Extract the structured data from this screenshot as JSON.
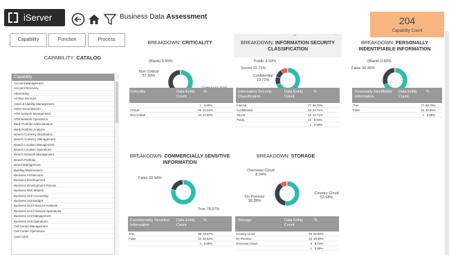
{
  "app": {
    "name": "iServer",
    "title_prefix": "Business Data ",
    "title_bold": "Assessment"
  },
  "kpi": {
    "value": "204",
    "label": "Capability Count",
    "color": "#f7b681"
  },
  "tabs": [
    "Capability",
    "Function",
    "Process"
  ],
  "catalog": {
    "prefix": "CAPABILITY: ",
    "bold": "CATALOG",
    "header": "Capability",
    "items": [
      "Account Management",
      "Account Recovery",
      "Advertising",
      "Archive Services",
      "Asset & Liability Management",
      "Asset Securitisation",
      "ATM Network Management",
      "ATM Network Operations",
      "Bank Portfolio Administration",
      "Bank Portfolio Analysis",
      "Branch Currency Distribution",
      "Branch Currency Management",
      "Branch Location Management",
      "Branch Location Operations",
      "Branch Network Management",
      "Branch Portfolio",
      "Brand Management",
      "Building Maintenance",
      "Business Architecture",
      "Business Development",
      "Business Development Policies",
      "Business Risk Models",
      "Business Unit Accounting",
      "Business Unit Budget",
      "Business Unit Financial Analysis",
      "Business Unit Financial Operations",
      "Business Unit Management",
      "Business Unit Operations",
      "Call Center Management",
      "Call Center Operations",
      "Card Case"
    ]
  },
  "charts": {
    "criticality": {
      "prefix": "BREAKDOWN: ",
      "bold": "CRITICALITY",
      "col1": "Criticality",
      "col2": "Data Entity Count",
      "col3": "%",
      "rows": [
        [
          "",
          "1",
          "0.89%"
        ],
        [
          "Critical",
          "69",
          "61.61%"
        ],
        [
          "Non Critical",
          "42",
          "37.50%"
        ]
      ],
      "labels": {
        "blank": "(Blank) 0.89%",
        "noncrit": "Non Critical 37.50%",
        "crit": "Critical 61.61%"
      }
    },
    "security": {
      "prefix": "BREAKDOWN: ",
      "bold": "INFORMATION SECURITY CLASSIFICATION",
      "col1": "Information Security Classification",
      "col2": "Data Entity Count",
      "col3": "%",
      "rows": [
        [
          "Internal",
          "77",
          "68.75%"
        ],
        [
          "Confidential",
          "12",
          "10.71%"
        ],
        [
          "Secret",
          "12",
          "10.71%"
        ],
        [
          "Public",
          "10",
          "8.93%"
        ],
        [
          "",
          "1",
          "0.89%"
        ]
      ],
      "labels": {
        "public": "Public 8.93%",
        "secret": "Secret 10.71%",
        "conf": "Confidential 10.71%",
        "internal": "Internal 68.75%"
      }
    },
    "pii": {
      "prefix": "BREAKDOWN: ",
      "bold": "PERSONALLY INDENTIFIABLE INFORMATION",
      "col1": "Personally Identifiable Information",
      "col2": "Data Entity Count",
      "col3": "%",
      "rows": [
        [
          "True",
          "77",
          "68.75%"
        ],
        [
          "False",
          "34",
          "30.36%"
        ],
        [
          "",
          "1",
          "0.89%"
        ]
      ],
      "labels": {
        "blank": "(Blank) 0.89%",
        "false": "False 30.36%",
        "true": "True 68.75%"
      }
    },
    "commercial": {
      "prefix": "BREAKDOWN: ",
      "bold": "COMMERCIALLY SENSITIVE INFORMATION",
      "col1": "Commercially Sensitive Information",
      "col2": "Data Entity Count",
      "col3": "%",
      "rows": [
        [
          "True",
          "88",
          "78.57%"
        ],
        [
          "False",
          "23",
          "20.54%"
        ],
        [
          "",
          "1",
          "0.89%"
        ]
      ],
      "labels": {
        "false": "False 20.54%",
        "true": "True 78.57%"
      }
    },
    "storage": {
      "prefix": "BREAKDOWN: ",
      "bold": "STORAGE",
      "col1": "Storage",
      "col2": "Data Entity Count",
      "col3": "%",
      "rows": [
        [
          "Country Cloud",
          "59",
          "52.68%"
        ],
        [
          "On Premise",
          "43",
          "38.39%"
        ],
        [
          "Overseas Cloud",
          "9",
          "8.04%"
        ],
        [
          "",
          "1",
          "0.89%"
        ]
      ],
      "labels": {
        "overseas": "Overseas Cloud 8.04%",
        "onprem": "On Premise 38.39%",
        "country": "Country Cloud 52.68%"
      }
    }
  },
  "colors": {
    "teal": "#2bbcad",
    "dark": "#3a4249",
    "red": "#f0575a",
    "yellow": "#f2c12e"
  }
}
